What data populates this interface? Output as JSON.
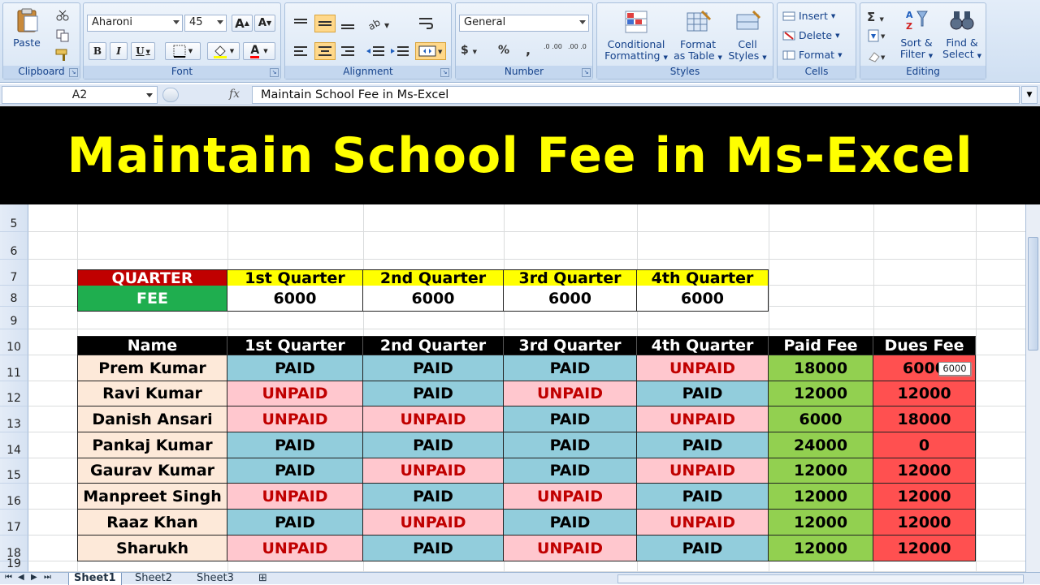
{
  "ribbon": {
    "clipboard": {
      "label": "Clipboard",
      "paste": "Paste"
    },
    "font": {
      "label": "Font",
      "family": "Aharoni",
      "size": "45",
      "grow": "A",
      "shrink": "A",
      "bold": "B",
      "italic": "I",
      "underline": "U",
      "font_color": "A"
    },
    "alignment": {
      "label": "Alignment"
    },
    "number": {
      "label": "Number",
      "format": "General",
      "currency": "$",
      "percent": "%",
      "comma": ",",
      "inc_dec": ".0 .00",
      "dec_dec": ".00 .0"
    },
    "styles": {
      "label": "Styles",
      "conditional_1": "Conditional",
      "conditional_2": "Formatting",
      "format_table_1": "Format",
      "format_table_2": "as Table",
      "cell_styles_1": "Cell",
      "cell_styles_2": "Styles"
    },
    "cells": {
      "label": "Cells",
      "insert": "Insert",
      "delete": "Delete",
      "format": "Format"
    },
    "editing": {
      "label": "Editing",
      "sum": "Σ",
      "sort_1": "Sort &",
      "sort_2": "Filter",
      "find_1": "Find &",
      "find_2": "Select"
    }
  },
  "formula_bar": {
    "name_box": "A2",
    "fx": "fx",
    "content": "Maintain School Fee in Ms-Excel"
  },
  "banner": {
    "title": "Maintain School Fee in Ms-Excel"
  },
  "row_numbers": [
    "5",
    "6",
    "7",
    "8",
    "9",
    "10",
    "11",
    "12",
    "13",
    "14",
    "15",
    "16",
    "17",
    "18",
    "19"
  ],
  "quarter_table": {
    "header_label": "QUARTER",
    "fee_label": "FEE",
    "quarters": [
      "1st Quarter",
      "2nd Quarter",
      "3rd Quarter",
      "4th Quarter"
    ],
    "fees": [
      "6000",
      "6000",
      "6000",
      "6000"
    ]
  },
  "fee_table": {
    "headers": [
      "Name",
      "1st Quarter",
      "2nd Quarter",
      "3rd Quarter",
      "4th Quarter",
      "Paid Fee",
      "Dues Fee"
    ],
    "rows": [
      [
        "Prem Kumar",
        "PAID",
        "PAID",
        "PAID",
        "UNPAID",
        "18000",
        "6000"
      ],
      [
        "Ravi Kumar",
        "UNPAID",
        "PAID",
        "UNPAID",
        "PAID",
        "12000",
        "12000"
      ],
      [
        "Danish Ansari",
        "UNPAID",
        "UNPAID",
        "PAID",
        "UNPAID",
        "6000",
        "18000"
      ],
      [
        "Pankaj Kumar",
        "PAID",
        "PAID",
        "PAID",
        "PAID",
        "24000",
        "0"
      ],
      [
        "Gaurav Kumar",
        "PAID",
        "UNPAID",
        "PAID",
        "UNPAID",
        "12000",
        "12000"
      ],
      [
        "Manpreet Singh",
        "UNPAID",
        "PAID",
        "UNPAID",
        "PAID",
        "12000",
        "12000"
      ],
      [
        "Raaz Khan",
        "PAID",
        "UNPAID",
        "PAID",
        "UNPAID",
        "12000",
        "12000"
      ],
      [
        "Sharukh",
        "UNPAID",
        "PAID",
        "UNPAID",
        "PAID",
        "12000",
        "12000"
      ]
    ]
  },
  "tooltip": "6000",
  "colors": {
    "quarter_red": "#c00000",
    "fee_green": "#1fae4f",
    "yellow": "#ffff00",
    "paid_blue": "#92cddc",
    "unpaid_pink": "#ffc7ce",
    "unpaid_text": "#c00000",
    "name_bg": "#fde9d9",
    "paid_fee_green": "#92d050",
    "dues_red": "#ff5050",
    "banner_text": "#ffff00"
  },
  "sheet_tabs": [
    "Sheet1",
    "Sheet2",
    "Sheet3"
  ]
}
